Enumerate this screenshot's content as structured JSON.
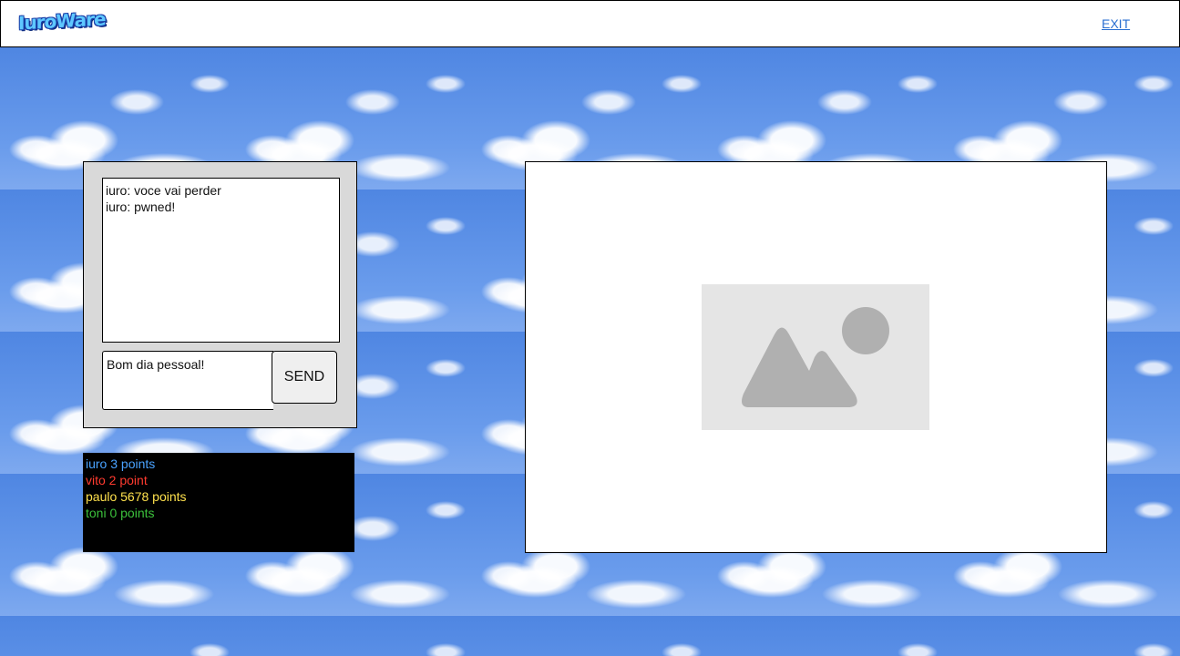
{
  "header": {
    "logo_text": "IuroWare",
    "exit_label": "EXIT"
  },
  "chat": {
    "messages": [
      "iuro: voce vai perder",
      "iuro: pwned!"
    ],
    "input_value": "Bom dia pessoal!",
    "send_label": "SEND"
  },
  "scoreboard": {
    "entries": [
      {
        "text": "iuro 3 points",
        "color": "#4aa3ff"
      },
      {
        "text": "vito 2 point",
        "color": "#ff3b2f"
      },
      {
        "text": "paulo 5678 points",
        "color": "#ffe14d"
      },
      {
        "text": "toni 0 points",
        "color": "#3cc23c"
      }
    ]
  },
  "game": {
    "placeholder_icon": "image-placeholder-icon"
  },
  "colors": {
    "accent_link": "#2a6fd1",
    "panel_bg": "#d9d9d9",
    "scoreboard_bg": "#000000"
  }
}
